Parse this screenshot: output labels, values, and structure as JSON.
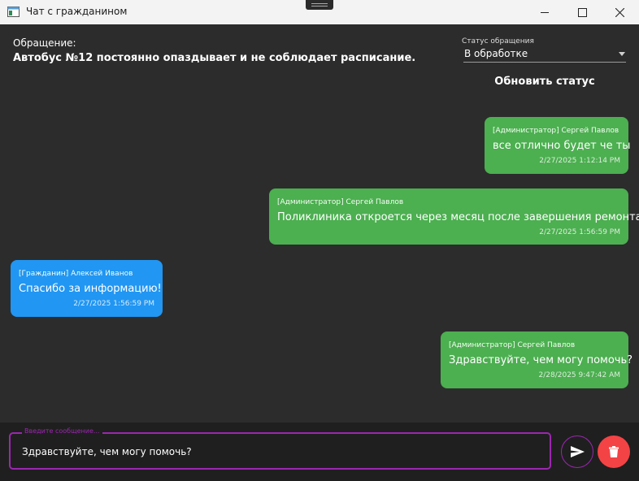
{
  "window": {
    "title": "Чат с гражданином",
    "icons": [
      "app-window-icon",
      "minimize-icon",
      "maximize-icon",
      "close-icon"
    ]
  },
  "request": {
    "label": "Обращение:",
    "text": "Автобус №12 постоянно опаздывает и не соблюдает расписание."
  },
  "status": {
    "label": "Статус обращения",
    "value": "В обработке",
    "update_button": "Обновить статус"
  },
  "messages": [
    {
      "role": "admin",
      "author": "[Администратор] Сергей Павлов",
      "text": "все отлично будет че ты",
      "time": "2/27/2025 1:12:14 PM"
    },
    {
      "role": "admin",
      "author": "[Администратор] Сергей Павлов",
      "text": "Поликлиника откроется через месяц после завершения ремонта.",
      "time": "2/27/2025 1:56:59 PM"
    },
    {
      "role": "citizen",
      "author": "[Гражданин] Алексей Иванов",
      "text": "Спасибо за информацию!",
      "time": "2/27/2025 1:56:59 PM"
    },
    {
      "role": "admin",
      "author": "[Администратор] Сергей Павлов",
      "text": "Здравствуйте, чем могу помочь?",
      "time": "2/28/2025 9:47:42 AM"
    }
  ],
  "composer": {
    "placeholder": "Введите сообщение...",
    "value": "Здравствуйте, чем могу помочь?",
    "send_icon": "send-icon",
    "delete_icon": "trash-icon"
  },
  "colors": {
    "admin_bubble": "#4caf50",
    "citizen_bubble": "#2196f3",
    "accent": "#9c27b0",
    "delete": "#f44345",
    "background": "#2c2c2c"
  }
}
